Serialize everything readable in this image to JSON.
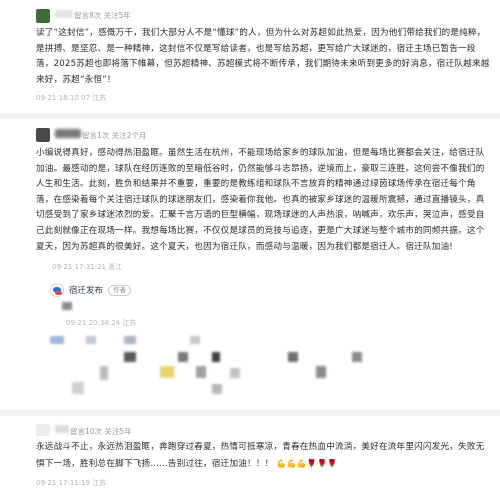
{
  "comments": [
    {
      "meta": "留言8次  关注5年",
      "text": "读了“这封信”，感慨万千，我们大部分人不是“懂球”的人，但为什么对苏超如此热爱，因为他们带给我们的是纯粹，是拼搏、是坚忍、是一种精神，这封信不仅是写给读者，也是写给苏超，更写给广大球迷的，宿迁主场已暂告一段落，2025苏超也即将落下帷幕，但苏超精神、苏超模式将不断传承，我们期待未来听到更多的好消息，宿迁队越来越来好，苏超“永恒”！",
      "timestamp": "09-21 18:10:07 江苏"
    },
    {
      "meta": "留言1次  关注2个月",
      "text": "小编说得真好，感动得热泪盈眶。虽然生活在杭州，不能现场给家乡的球队加油，但是每场比赛都会关注，给宿迁队加油。最感动的是，球队在经历连败的至暗低谷时，仍然能够斗志昂扬，逆境而上，豪取三连胜。这何尝不像我们的人生和生活。此刻，胜负和结果并不重要，重要的是教练组和球队不言放弃的精神通过绿茵球场传承在宿迁每个角落，在感染着每个关注宿迁球队的球迷朋友们，感染着你我他。也真的被家乡球迷的温暖所震撼，通过直播镜头，真切感受到了家乡球迷浓烈的爱。汇聚千言万语的巨型横幅，现场球迷的人声热浪，呐喊声，欢乐声，哭泣声，感受自己此刻就像正在现场一样。我想每场比赛，不仅仅是球员的竞技与追逐，更是广大球迷与整个城市的同频共振。这个夏天，因为苏超真的很美好。这个夏天，也因为宿迁队，而感动与温暖，因为我们都是宿迁人。宿迁队加油!",
      "timestamp": "09-21 17:31:21 浙江",
      "reply": {
        "name": "宿迁发布",
        "tag": "作者",
        "timestamp": "09-21 20:34:24 江苏"
      }
    },
    {
      "meta": "留言10次  关注5年",
      "text": "永远战斗不止，永远热泪盈眶，奔跑穿过春夏，热情可抵寒凉，青春在热血中流淌，美好在流年里闪闪发光，失败无惧下一场，胜利总在脚下飞扬……告别过往，宿迁加油！！！",
      "emojis": "💪💪💪🌹🌹🌹",
      "timestamp": "09-21 17:11:19 江苏"
    }
  ]
}
